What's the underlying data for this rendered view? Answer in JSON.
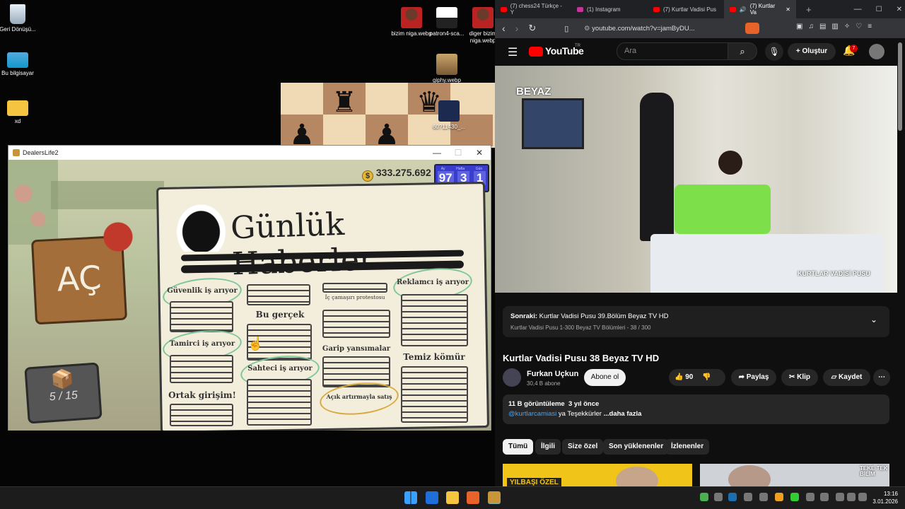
{
  "desktop": {
    "icons": [
      {
        "label": "Geri Dönüşü...",
        "icon": "recycle-bin-icon"
      },
      {
        "label": "Bu bilgisayar",
        "icon": "computer-icon"
      },
      {
        "label": "xd",
        "icon": "folder-icon"
      },
      {
        "label": "bizim niga.webp",
        "icon": "image-file-icon"
      },
      {
        "label": "patron4-sca...",
        "icon": "image-file-icon"
      },
      {
        "label": "diger bizim niga.webp",
        "icon": "image-file-icon"
      },
      {
        "label": "giphy.webp",
        "icon": "image-file-icon"
      },
      {
        "label": "60?11430_...",
        "icon": "image-file-icon"
      }
    ]
  },
  "game": {
    "window_title": "DealersLife2",
    "money": "333.275.692",
    "stats": {
      "labels": [
        "Ay",
        "Hafta",
        "Gün"
      ],
      "values": [
        "97",
        "3",
        "1"
      ]
    },
    "open_sign": "AÇ",
    "inventory": "5 / 15",
    "newspaper": {
      "title": "Günlük Haberler",
      "items": [
        "Güvenlik iş arıyor",
        "Bu gerçek",
        "İç çamaşırı protestosu",
        "Reklamcı iş arıyor",
        "Tamirci iş arıyor",
        "Garip yansımalar",
        "Temiz kömür",
        "Sahteci iş arıyor",
        "Ortak girişim!",
        "Açık artırmayla satış"
      ]
    }
  },
  "browser": {
    "tabs": [
      {
        "label": "(7) chess24 Türkçe - Y"
      },
      {
        "label": "(1) Instagram"
      },
      {
        "label": "(7) Kurtlar Vadisi Pus"
      },
      {
        "label": "(7) Kurtlar Va"
      }
    ],
    "url": "youtube.com/watch?v=jamByDU...",
    "youtube": {
      "logo": "YouTube",
      "region": "TR",
      "search_placeholder": "Ara",
      "create_label": "Oluştur",
      "notif_count": "7",
      "video_watermark": "BEYAZ",
      "video_overlay_title": "KURTLAR VADİSİ PUSU",
      "next_label": "Sonraki:",
      "next_title": "Kurtlar Vadisi Pusu 39.Bölüm Beyaz TV HD",
      "playlist_info": "Kurtlar Vadisi Pusu 1-300 Beyaz TV Bölümleri - 38 / 300",
      "video_title": "Kurtlar Vadisi Pusu 38 Beyaz TV HD",
      "channel_name": "Furkan Uçkun",
      "subscribers": "30,4 B abone",
      "subscribe_label": "Abone ol",
      "likes": "90",
      "share_label": "Paylaş",
      "clip_label": "Klip",
      "save_label": "Kaydet",
      "views": "11 B görüntüleme",
      "age": "3 yıl önce",
      "desc_mention": "@kurtlarcamiasi",
      "desc_rest": "ya Teşekkürler",
      "more_label": "...daha fazla",
      "chips": [
        "Tümü",
        "İlgili",
        "Size özel",
        "Son yüklenenler",
        "İzlenenler"
      ],
      "thumb1_text": "YILBAŞI ÖZEL",
      "thumb2_text": "TEKE TEK BİLİM"
    }
  },
  "taskbar": {
    "time": "13:16",
    "date": "3.01.2026"
  }
}
